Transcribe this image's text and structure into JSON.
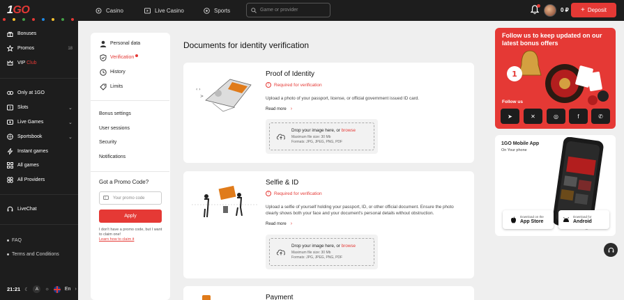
{
  "brand": {
    "logo_text_1": "1",
    "logo_text_2": "GO",
    "accent": "#e53935"
  },
  "topnav": {
    "items": [
      {
        "label": "Casino"
      },
      {
        "label": "Live Casino"
      },
      {
        "label": "Sports"
      }
    ],
    "search_placeholder": "Game or provider",
    "balance": "0 ₽",
    "deposit_label": "Deposit"
  },
  "sidebar": {
    "group1": [
      {
        "label": "Bonuses"
      },
      {
        "label": "Promos",
        "count": "18"
      },
      {
        "label": "VIP",
        "label_accent": "Club"
      }
    ],
    "group2": [
      {
        "label": "Only at 1GO"
      },
      {
        "label": "Slots"
      },
      {
        "label": "Live Games"
      },
      {
        "label": "Sportsbook"
      },
      {
        "label": "Instant games"
      },
      {
        "label": "All games"
      },
      {
        "label": "All Providers"
      }
    ],
    "livechat": "LiveChat",
    "links": [
      {
        "label": "FAQ"
      },
      {
        "label": "Terms and Conditions"
      }
    ],
    "time": "21:21",
    "theme_letter": "A",
    "lang": "En"
  },
  "profile_menu": {
    "items": [
      {
        "label": "Personal data"
      },
      {
        "label": "Verification"
      },
      {
        "label": "History"
      },
      {
        "label": "Limits"
      }
    ],
    "sub_items": [
      {
        "label": "Bonus settings"
      },
      {
        "label": "User sessions"
      },
      {
        "label": "Security"
      },
      {
        "label": "Notifications"
      }
    ],
    "promo": {
      "title": "Got a Promo Code?",
      "placeholder": "Your promo code",
      "apply": "Apply",
      "note": "I don't have a promo code, but I want to claim one!",
      "link": "Learn how to claim it"
    }
  },
  "main": {
    "title": "Documents for identity verification",
    "sections": [
      {
        "title": "Proof of Identity",
        "status": "Required for verification",
        "description": "Upload a photo of your passport, license, or official government issued ID card.",
        "read_more": "Read more",
        "drop": {
          "text": "Drop your image here, or ",
          "link": "browse",
          "size": "Maximum file size: 30 Mb",
          "formats": "Formats: JPG, JPEG, PNG, PDF"
        }
      },
      {
        "title": "Selfie & ID",
        "status": "Required for verification",
        "description": "Upload a selfie of yourself holding your passport, ID, or other official document. Ensure the photo clearly shows both your face and your document's personal details without obstruction.",
        "read_more": "Read more",
        "drop": {
          "text": "Drop your image here, or ",
          "link": "browse",
          "size": "Maximum file size: 30 Mb",
          "formats": "Formats: JPG, JPEG, PNG, PDF"
        }
      },
      {
        "title": "Payment"
      }
    ]
  },
  "right": {
    "promo_banner": {
      "heading": "Follow us to keep updated on our latest bonus offers",
      "follow": "Follow us",
      "socials": [
        "telegram-icon",
        "x-icon",
        "instagram-icon",
        "facebook-icon",
        "whatsapp-icon"
      ]
    },
    "app": {
      "title": "1GO Mobile App",
      "subtitle": "On Your phone",
      "ios_small": "Download on the",
      "ios_big": "App Store",
      "android_small": "Download for",
      "android_big": "Android"
    }
  }
}
